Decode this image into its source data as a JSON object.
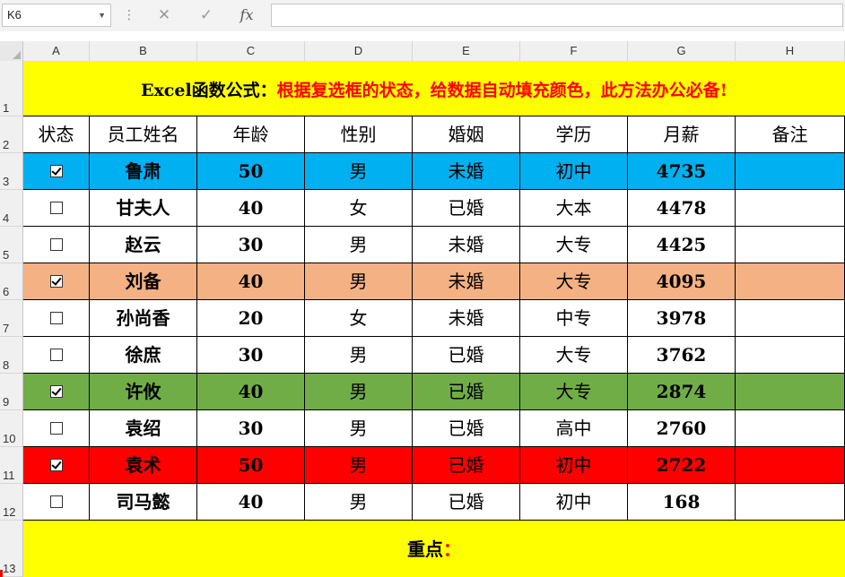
{
  "namebox": {
    "value": "K6"
  },
  "formula_bar": {
    "cancel_icon": "✕",
    "enter_icon": "✓",
    "fx_label": "fx",
    "value": ""
  },
  "columns": [
    "A",
    "B",
    "C",
    "D",
    "E",
    "F",
    "G",
    "H"
  ],
  "row_numbers": [
    "1",
    "2",
    "3",
    "4",
    "5",
    "6",
    "7",
    "8",
    "9",
    "10",
    "11",
    "12",
    "13"
  ],
  "title": {
    "prefix": "Excel函数公式：",
    "main": "根据复选框的状态，给数据自动填充颜色，此方法办公必备!"
  },
  "headers": [
    "状态",
    "员工姓名",
    "年龄",
    "性别",
    "婚姻",
    "学历",
    "月薪",
    "备注"
  ],
  "rows": [
    {
      "checked": true,
      "name": "鲁肃",
      "age": "50",
      "gender": "男",
      "marriage": "未婚",
      "edu": "初中",
      "salary": "4735",
      "note": "",
      "bg": "#00b0f0",
      "text": "#000000"
    },
    {
      "checked": false,
      "name": "甘夫人",
      "age": "40",
      "gender": "女",
      "marriage": "已婚",
      "edu": "大本",
      "salary": "4478",
      "note": "",
      "bg": "#ffffff",
      "text": "#000000"
    },
    {
      "checked": false,
      "name": "赵云",
      "age": "30",
      "gender": "男",
      "marriage": "未婚",
      "edu": "大专",
      "salary": "4425",
      "note": "",
      "bg": "#ffffff",
      "text": "#000000"
    },
    {
      "checked": true,
      "name": "刘备",
      "age": "40",
      "gender": "男",
      "marriage": "未婚",
      "edu": "大专",
      "salary": "4095",
      "note": "",
      "bg": "#f4b183",
      "text": "#000000"
    },
    {
      "checked": false,
      "name": "孙尚香",
      "age": "20",
      "gender": "女",
      "marriage": "未婚",
      "edu": "中专",
      "salary": "3978",
      "note": "",
      "bg": "#ffffff",
      "text": "#000000"
    },
    {
      "checked": false,
      "name": "徐庶",
      "age": "30",
      "gender": "男",
      "marriage": "已婚",
      "edu": "大专",
      "salary": "3762",
      "note": "",
      "bg": "#ffffff",
      "text": "#000000"
    },
    {
      "checked": true,
      "name": "许攸",
      "age": "40",
      "gender": "男",
      "marriage": "已婚",
      "edu": "大专",
      "salary": "2874",
      "note": "",
      "bg": "#70ad47",
      "text": "#000000"
    },
    {
      "checked": false,
      "name": "袁绍",
      "age": "30",
      "gender": "男",
      "marriage": "已婚",
      "edu": "高中",
      "salary": "2760",
      "note": "",
      "bg": "#ffffff",
      "text": "#000000"
    },
    {
      "checked": true,
      "name": "袁术",
      "age": "50",
      "gender": "男",
      "marriage": "已婚",
      "edu": "初中",
      "salary": "2722",
      "note": "",
      "bg": "#ff0000",
      "text": "#000000"
    },
    {
      "checked": false,
      "name": "司马懿",
      "age": "40",
      "gender": "男",
      "marriage": "已婚",
      "edu": "初中",
      "salary": "168",
      "note": "",
      "bg": "#ffffff",
      "text": "#000000"
    }
  ],
  "footer": {
    "label": "重点",
    "colon": "："
  },
  "colors": {
    "title_bg": "#ffff00",
    "title_red": "#ff0000"
  }
}
